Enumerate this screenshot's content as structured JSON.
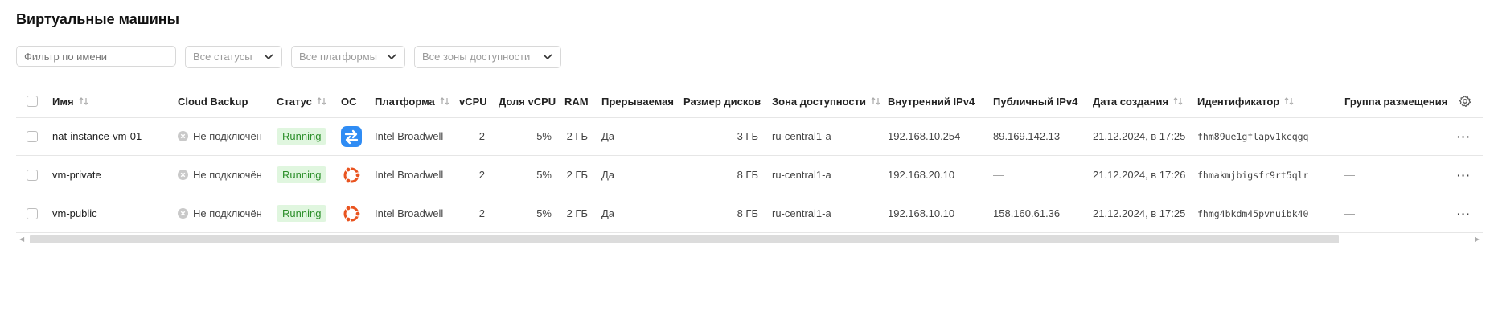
{
  "page": {
    "title": "Виртуальные машины"
  },
  "filters": {
    "name_placeholder": "Фильтр по имени",
    "status": "Все статусы",
    "platform": "Все платформы",
    "zone": "Все зоны доступности"
  },
  "columns": {
    "name": "Имя",
    "backup": "Cloud Backup",
    "status": "Статус",
    "os": "ОС",
    "platform": "Платформа",
    "vcpu": "vCPU",
    "vcpu_share": "Доля vCPU",
    "ram": "RAM",
    "preemptible": "Прерываемая",
    "disk_size": "Размер дисков",
    "zone": "Зона доступности",
    "ipv4_internal": "Внутренний IPv4",
    "ipv4_public": "Публичный IPv4",
    "created": "Дата создания",
    "id": "Идентификатор",
    "placement": "Группа размещения"
  },
  "rows": [
    {
      "name": "nat-instance-vm-01",
      "backup": "Не подключён",
      "status": "Running",
      "os": "nat-instance-icon",
      "platform": "Intel Broadwell",
      "vcpu": "2",
      "vcpu_share": "5%",
      "ram": "2 ГБ",
      "preemptible": "Да",
      "disk_size": "3 ГБ",
      "zone": "ru-central1-a",
      "ipv4_internal": "192.168.10.254",
      "ipv4_public": "89.169.142.13",
      "created": "21.12.2024, в 17:25",
      "id": "fhm89ue1gflapv1kcqgq",
      "placement": "—"
    },
    {
      "name": "vm-private",
      "backup": "Не подключён",
      "status": "Running",
      "os": "ubuntu-icon",
      "platform": "Intel Broadwell",
      "vcpu": "2",
      "vcpu_share": "5%",
      "ram": "2 ГБ",
      "preemptible": "Да",
      "disk_size": "8 ГБ",
      "zone": "ru-central1-a",
      "ipv4_internal": "192.168.20.10",
      "ipv4_public": "—",
      "created": "21.12.2024, в 17:26",
      "id": "fhmakmjbigsfr9rt5qlr",
      "placement": "—"
    },
    {
      "name": "vm-public",
      "backup": "Не подключён",
      "status": "Running",
      "os": "ubuntu-icon",
      "platform": "Intel Broadwell",
      "vcpu": "2",
      "vcpu_share": "5%",
      "ram": "2 ГБ",
      "preemptible": "Да",
      "disk_size": "8 ГБ",
      "zone": "ru-central1-a",
      "ipv4_internal": "192.168.10.10",
      "ipv4_public": "158.160.61.36",
      "created": "21.12.2024, в 17:25",
      "id": "fhmg4bkdm45pvnuibk40",
      "placement": "—"
    }
  ],
  "row_menu_label": "···",
  "colors": {
    "status_bg": "#e0f6df",
    "status_text": "#2c8f2a",
    "ubuntu": "#e95420",
    "nat_icon": "#2f8cf4"
  }
}
